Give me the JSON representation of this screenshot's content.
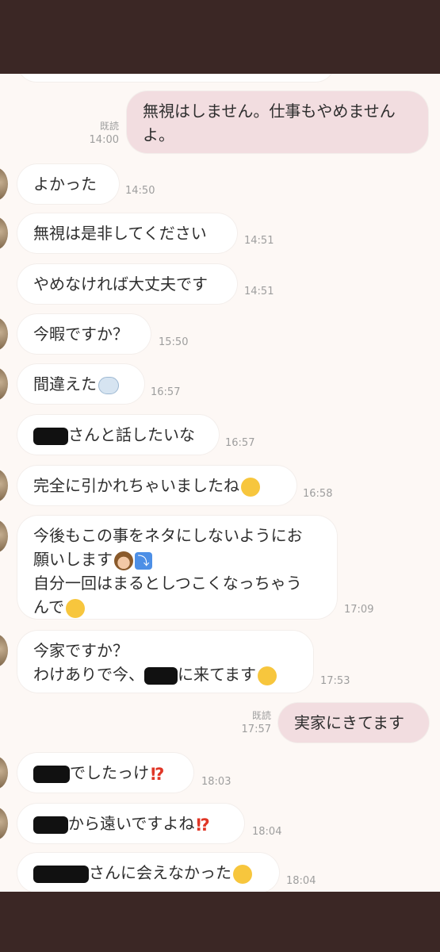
{
  "read_label": "既読",
  "messages": [
    {
      "text": "無視はしません。仕事もやめません",
      "text2": "よ。",
      "time": "14:00"
    },
    {
      "text": "よかった",
      "time": "14:50"
    },
    {
      "text": "無視は是非してください",
      "time": "14:51"
    },
    {
      "text": "やめなければ大丈夫です",
      "time": "14:51"
    },
    {
      "text": "今暇ですか？",
      "time": "15:50"
    },
    {
      "text": "間違えた",
      "time": "16:57"
    },
    {
      "text": "さんと話したいな",
      "time": "16:57"
    },
    {
      "text": "完全に引かれちゃいましたね",
      "time": "16:58"
    },
    {
      "line1": "今後もこの事をネタにしないようにお",
      "line2": "願いします",
      "line3": "自分一回はまるとしつこくなっちゃう",
      "line4": "んで",
      "time": "17:09"
    },
    {
      "line1": "今家ですか？",
      "line2a": "わけありで今、",
      "line2b": "に来てます",
      "time": "17:53"
    },
    {
      "text": "実家にきてます",
      "time": "17:57"
    },
    {
      "text": "でしたっけ",
      "time": "18:03"
    },
    {
      "text": "から遠いですよね",
      "time": "18:04"
    },
    {
      "text": "さんに会えなかった",
      "time": "18:04"
    }
  ],
  "icons": {
    "sob": "loudly-crying-face",
    "wind": "dash-symbol",
    "bow": "person-bowing",
    "arrow": "right-arrow-curving-down",
    "sweat": "grinning-face-with-sweat",
    "grin": "grinning-face",
    "exclaim": "exclamation-question-mark",
    "persevere": "persevering-face"
  }
}
